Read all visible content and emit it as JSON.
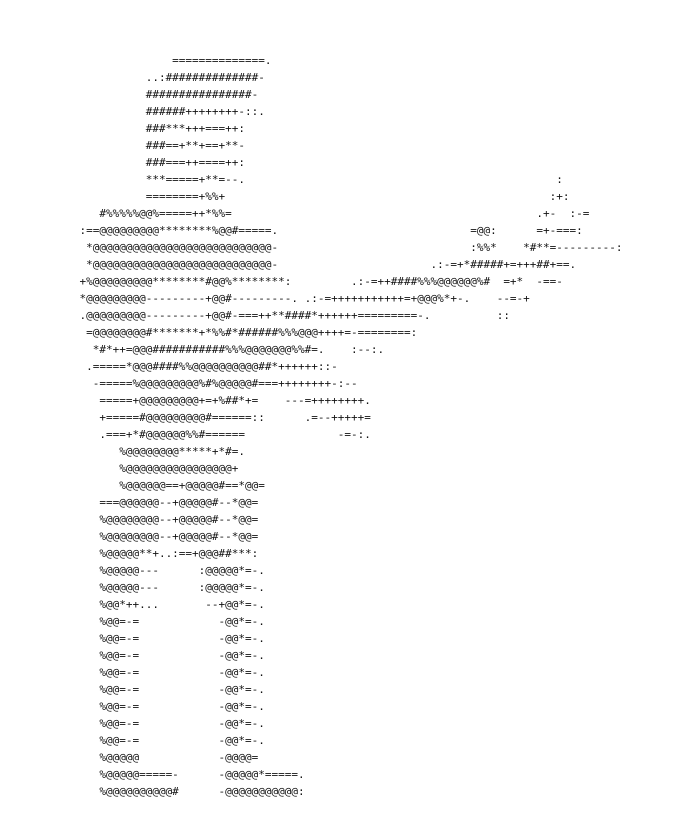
{
  "art": {
    "lines": [
      "                          ==============.",
      "                      ..:##############-",
      "                      ################-",
      "                      ######++++++++-::.",
      "                      ###***+++===++:",
      "                      ###==+**+==+**-",
      "                      ###===++====++:",
      "                      ***=====+**=--.                                               :",
      "                      ========+%%+                                                 :+:",
      "               #%%%%%@@%=====++*%%=                                              .+-  :-=",
      "            :==@@@@@@@@@********%@@#=====.                             =@@:      =+-===:",
      "             *@@@@@@@@@@@@@@@@@@@@@@@@@@@-                             :%%*    *#**=---------:",
      "             *@@@@@@@@@@@@@@@@@@@@@@@@@@@-                       .:-=+*#####+=+++##+==.",
      "            +%@@@@@@@@@********#@@%********:         .:-=++####%%%@@@@@@%#  =+*  -==-",
      "            *@@@@@@@@@---------+@@#---------. .:-=+++++++++++=+@@@%*+-.    --=-+",
      "            .@@@@@@@@@---------+@@#-===++**####*++++++=========-.          ::",
      "             =@@@@@@@@#*******+*%%#*######%%%@@@++++=-========:",
      "              *#*++=@@@###########%%%@@@@@@@%%#=.    :--:.",
      "             .=====*@@@####%%@@@@@@@@@@##*++++++::-",
      "              -=====%@@@@@@@@@%#%@@@@@#===++++++++-:--",
      "               =====+@@@@@@@@@+=+%##*+=    ---=++++++++.",
      "               +=====#@@@@@@@@@#======::      .=--+++++=",
      "               .===+*#@@@@@@%%#======              -=-:.",
      "                  %@@@@@@@@*****+*#=.",
      "                  %@@@@@@@@@@@@@@@@+",
      "                  %@@@@@@==+@@@@@#==*@@=",
      "               ===@@@@@@--+@@@@@#--*@@=",
      "               %@@@@@@@@--+@@@@@#--*@@=",
      "               %@@@@@@@@--+@@@@@#--*@@=",
      "               %@@@@@**+..:==+@@@##***:",
      "               %@@@@@---      :@@@@@*=-.",
      "               %@@@@@---      :@@@@@*=-.",
      "               %@@*++...       --+@@*=-.",
      "               %@@=-=            -@@*=-.",
      "               %@@=-=            -@@*=-.",
      "               %@@=-=            -@@*=-.",
      "               %@@=-=            -@@*=-.",
      "               %@@=-=            -@@*=-.",
      "               %@@=-=            -@@*=-.",
      "               %@@=-=            -@@*=-.",
      "               %@@=-=            -@@*=-.",
      "               %@@@@@            -@@@@=",
      "               %@@@@@=====-      -@@@@@*=====.",
      "               %@@@@@@@@@@#      -@@@@@@@@@@@:"
    ]
  }
}
